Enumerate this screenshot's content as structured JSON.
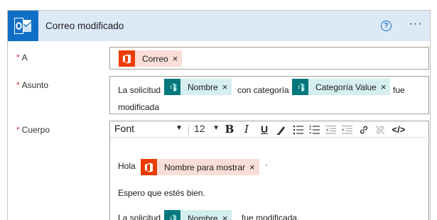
{
  "header": {
    "title": "Correo modificado",
    "help_glyph": "?",
    "more_glyph": "···",
    "app_icon": "outlook-icon",
    "accent": "#0f6fc6",
    "header_bg": "#dce9f7"
  },
  "fields": {
    "to": {
      "label": "A",
      "required_mark": "*",
      "tokens": [
        {
          "label": "Correo",
          "source": "office365"
        }
      ]
    },
    "subject": {
      "label": "Asunto",
      "required_mark": "*",
      "prefix": "La solicitud",
      "token1": "Nombre",
      "middle": "con categoría",
      "token2": "Categoría Value",
      "suffix": "fue",
      "line2": "modificada"
    },
    "body": {
      "label": "Cuerpo",
      "required_mark": "*",
      "toolbar": {
        "font": "Font",
        "size": "12",
        "bold": "B",
        "italic": "I",
        "underline": "U",
        "code": "</>"
      },
      "greeting": "Hola",
      "greeting_token": "Nombre para mostrar",
      "greeting_end": "·",
      "line2": "Espero que estés bien.",
      "line3_prefix": "La solicitud",
      "line3_token": "Nombre",
      "line3_suffix": "fue modificada."
    }
  },
  "token_close": "×",
  "colors": {
    "office365_icon": "#eb3c00",
    "office365_token_bg": "#f9ded7",
    "sharepoint_icon": "#03787c",
    "sharepoint_token_bg": "#d5eef0",
    "required": "#d13438"
  }
}
